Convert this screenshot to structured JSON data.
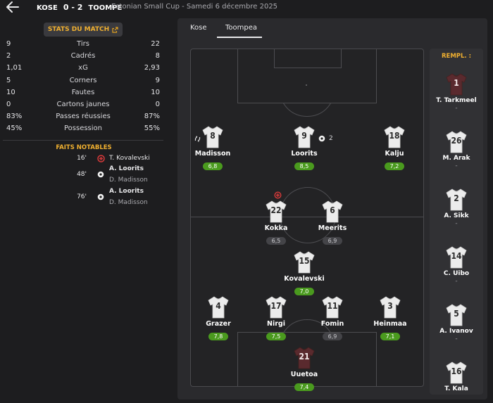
{
  "header": {
    "home": "KOSE",
    "score": "0 - 2",
    "away": "TOOMPE",
    "competition": "Estonian Small Cup  -  Samedi 6 décembre 2025"
  },
  "stats_button": "STATS DU MATCH",
  "stats": [
    {
      "l": "9",
      "label": "Tirs",
      "r": "22"
    },
    {
      "l": "2",
      "label": "Cadrés",
      "r": "8"
    },
    {
      "l": "1,01",
      "label": "xG",
      "r": "2,93"
    },
    {
      "l": "5",
      "label": "Corners",
      "r": "9"
    },
    {
      "l": "10",
      "label": "Fautes",
      "r": "10"
    },
    {
      "l": "0",
      "label": "Cartons jaunes",
      "r": "0"
    },
    {
      "l": "83%",
      "label": "Passes réussies",
      "r": "87%"
    },
    {
      "l": "45%",
      "label": "Possession",
      "r": "55%"
    }
  ],
  "notable_title": "FAITS NOTABLES",
  "events": [
    {
      "minute": "16'",
      "icon": "injury-icon",
      "name": "T. Kovalevski",
      "assist": ""
    },
    {
      "minute": "48'",
      "icon": "ball-icon",
      "name": "A. Loorits",
      "assist": "D. Madisson"
    },
    {
      "minute": "76'",
      "icon": "ball-icon",
      "name": "A. Loorits",
      "assist": "D. Madisson"
    }
  ],
  "tabs": [
    "Kose",
    "Toompea"
  ],
  "active_tab": "Toompea",
  "subs_title": "REMPL. :",
  "players": [
    {
      "num": "8",
      "name": "Madisson",
      "rating": "6,8",
      "rating_color": "green"
    },
    {
      "num": "9",
      "name": "Loorits",
      "rating": "8,5",
      "rating_color": "green",
      "goals": "2"
    },
    {
      "num": "18",
      "name": "Kalju",
      "rating": "7,2",
      "rating_color": "green"
    },
    {
      "num": "22",
      "name": "Kokka",
      "rating": "6,5",
      "rating_color": "grey"
    },
    {
      "num": "6",
      "name": "Meerits",
      "rating": "6,9",
      "rating_color": "grey"
    },
    {
      "num": "15",
      "name": "Kovalevski",
      "rating": "7,0",
      "rating_color": "green"
    },
    {
      "num": "4",
      "name": "Grazer",
      "rating": "7,8",
      "rating_color": "green"
    },
    {
      "num": "17",
      "name": "Nirgi",
      "rating": "7,5",
      "rating_color": "green"
    },
    {
      "num": "11",
      "name": "Fomin",
      "rating": "6,9",
      "rating_color": "grey"
    },
    {
      "num": "3",
      "name": "Heinmaa",
      "rating": "7,1",
      "rating_color": "green"
    },
    {
      "num": "21",
      "name": "Uuetoa",
      "rating": "7,4",
      "rating_color": "green"
    }
  ],
  "subs": [
    {
      "num": "1",
      "name": "T. Tarkmeel",
      "rating": "-"
    },
    {
      "num": "26",
      "name": "M. Arak",
      "rating": "-"
    },
    {
      "num": "2",
      "name": "A. Sikk",
      "rating": "-"
    },
    {
      "num": "14",
      "name": "C. Uibo",
      "rating": "-"
    },
    {
      "num": "5",
      "name": "A. Ivanov",
      "rating": "-"
    },
    {
      "num": "16",
      "name": "T. Kala",
      "rating": ""
    }
  ],
  "colors": {
    "accent": "#f0b030",
    "rating_green": "#4a9a1e",
    "gk_shirt": "#5a2a2e"
  }
}
